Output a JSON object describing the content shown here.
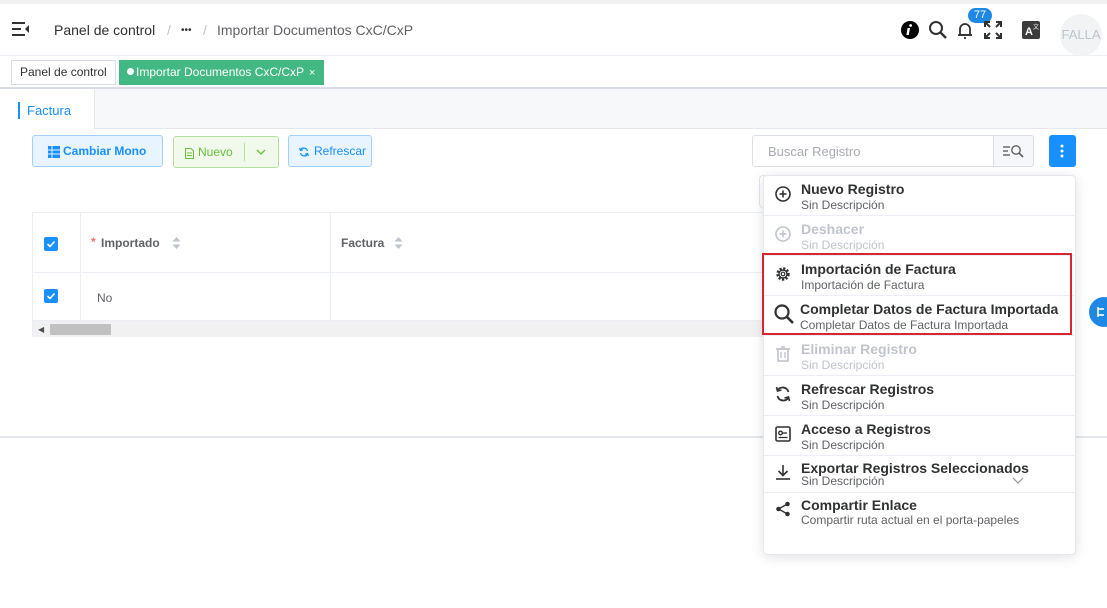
{
  "header": {
    "breadcrumb": {
      "home": "Panel de control",
      "sep1": "/",
      "ellipsis": "•••",
      "sep2": "/",
      "current": "Importar Documentos CxC/CxP"
    },
    "notification_count": "77",
    "avatar_text": "FALLA",
    "icons": [
      "menu-fold-icon",
      "info-icon",
      "search-icon",
      "bell-icon",
      "fullscreen-icon",
      "translate-icon"
    ]
  },
  "tags": [
    {
      "label": "Panel de control",
      "active": false
    },
    {
      "label": "Importar Documentos CxC/CxP",
      "active": true,
      "close": "×"
    }
  ],
  "tab": {
    "label": "Factura"
  },
  "toolbar": {
    "cambiar_mono": "Cambiar Mono",
    "nuevo": "Nuevo",
    "refrescar": "Refrescar",
    "search_placeholder": "Buscar Registro"
  },
  "table": {
    "columns": [
      {
        "label": "Importado",
        "required": "*"
      },
      {
        "label": "Factura"
      }
    ],
    "rows": [
      {
        "importado": "No",
        "factura": ""
      }
    ]
  },
  "menu": {
    "items": [
      {
        "title": "Nuevo Registro",
        "desc": "Sin Descripción",
        "icon": "plus-circle-icon",
        "disabled": false
      },
      {
        "title": "Deshacer",
        "desc": "Sin Descripción",
        "icon": "plus-circle-icon",
        "disabled": true
      },
      {
        "title": "Importación de Factura",
        "desc": "Importación de Factura",
        "icon": "gear-icon",
        "disabled": false
      },
      {
        "title": "Completar Datos de Factura Importada",
        "desc": "Completar Datos de Factura Importada",
        "icon": "search-icon",
        "disabled": false
      },
      {
        "title": "Eliminar Registro",
        "desc": "Sin Descripción",
        "icon": "trash-icon",
        "disabled": true
      },
      {
        "title": "Refrescar Registros",
        "desc": "Sin Descripción",
        "icon": "refresh-icon",
        "disabled": false
      },
      {
        "title": "Acceso a Registros",
        "desc": "Sin Descripción",
        "icon": "key-card-icon",
        "disabled": false
      },
      {
        "title": "Exportar Registros Seleccionados",
        "desc": "Sin Descripción",
        "icon": "download-icon",
        "disabled": false
      },
      {
        "title": "Compartir Enlace",
        "desc": "Compartir ruta actual en el porta-papeles",
        "icon": "share-icon",
        "disabled": false
      }
    ]
  },
  "colors": {
    "primary": "#1890ff",
    "success": "#42b983",
    "highlight": "#d6262e"
  }
}
